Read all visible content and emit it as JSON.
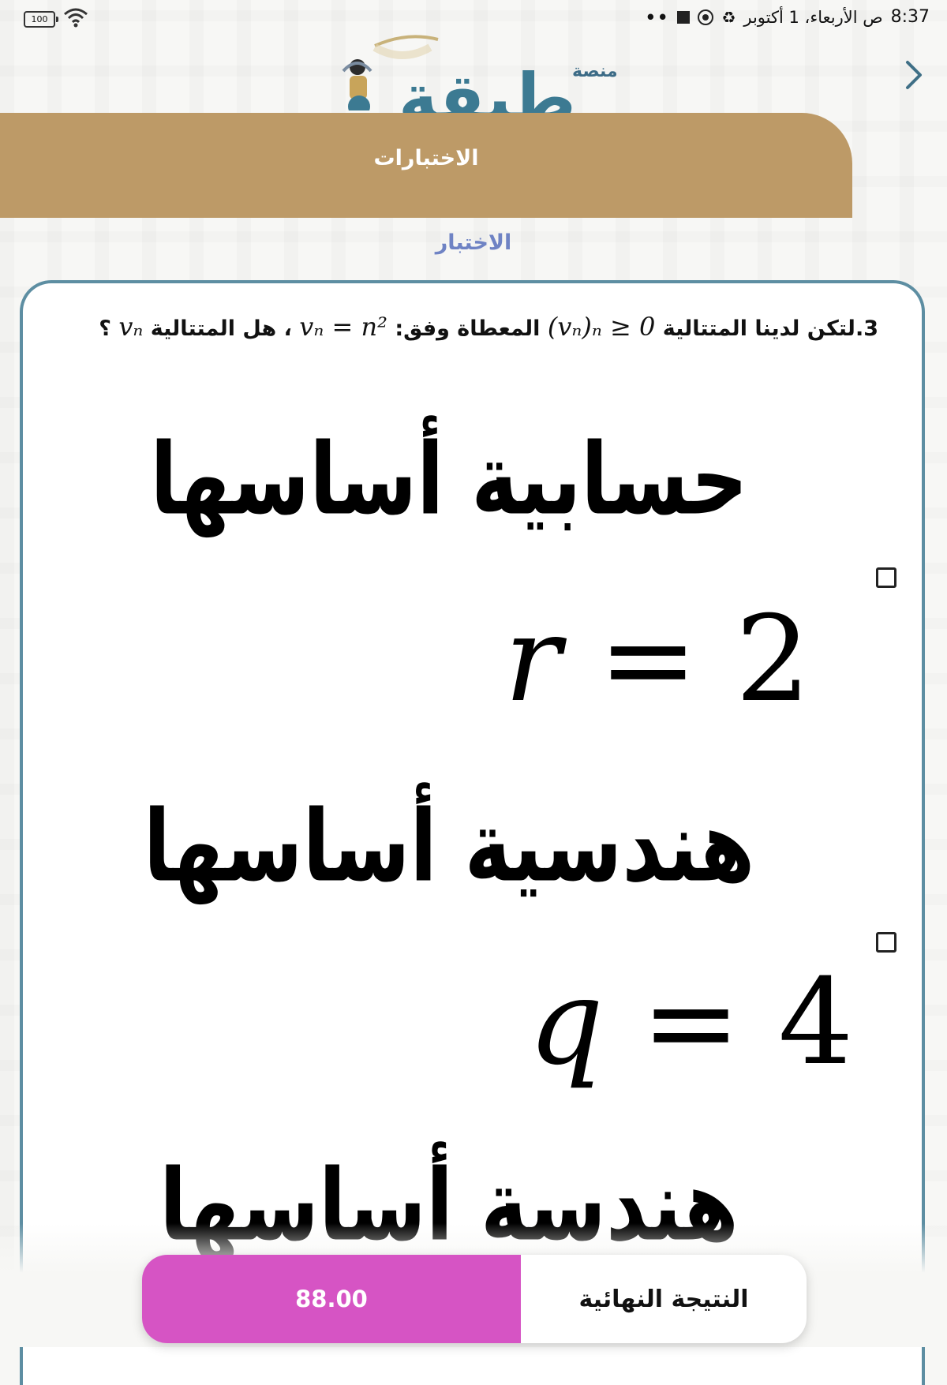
{
  "status_bar": {
    "battery": "100",
    "time": "8:37",
    "date": "ص الأربعاء، 1 أكتوبر",
    "dots": "••"
  },
  "header": {
    "back_icon": "chevron-right-icon",
    "logo_small": "منصة",
    "logo_big": "طبقة"
  },
  "banner": {
    "title": "الاختبارات"
  },
  "page": {
    "subtitle": "الاختبار"
  },
  "question": {
    "number_prefix": "3.",
    "text_start": "لتكن لدينا المتتالية",
    "math_1": "(vₙ)ₙ ≥ 0",
    "text_mid": "المعطاة وفق:",
    "math_2": "vₙ = n²",
    "text_end": "، هل المتتالية",
    "math_3": "vₙ",
    "q_mark": "؟"
  },
  "options": [
    {
      "text": "حسابية أساسها",
      "math_var": "r",
      "math_rest": " = 2"
    },
    {
      "text": "هندسية أساسها",
      "math_var": "q",
      "math_rest": " = 4"
    },
    {
      "text": "هندسة أساسها"
    }
  ],
  "result": {
    "label": "النتيجة النهائية",
    "score": "88.00"
  },
  "colors": {
    "banner": "#bd9a67",
    "accent_teal": "#5d8ea2",
    "subtitle": "#6f83c4",
    "score_bg": "#d654c4"
  }
}
